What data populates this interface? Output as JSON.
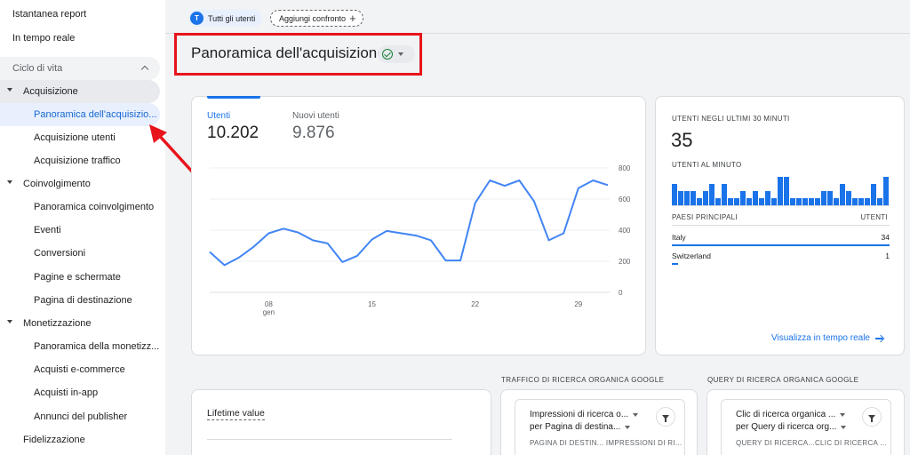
{
  "sidebar": {
    "items": [
      {
        "label": "Istantanea report"
      },
      {
        "label": "In tempo reale"
      },
      {
        "label": "Ciclo di vita"
      },
      {
        "label": "Acquisizione"
      },
      {
        "label": "Panoramica dell'acquisizio..."
      },
      {
        "label": "Acquisizione utenti"
      },
      {
        "label": "Acquisizione traffico"
      },
      {
        "label": "Coinvolgimento"
      },
      {
        "label": "Panoramica coinvolgimento"
      },
      {
        "label": "Eventi"
      },
      {
        "label": "Conversioni"
      },
      {
        "label": "Pagine e schermate"
      },
      {
        "label": "Pagina di destinazione"
      },
      {
        "label": "Monetizzazione"
      },
      {
        "label": "Panoramica della monetizz..."
      },
      {
        "label": "Acquisti e-commerce"
      },
      {
        "label": "Acquisti in-app"
      },
      {
        "label": "Annunci del publisher"
      },
      {
        "label": "Fidelizzazione"
      }
    ]
  },
  "topbar": {
    "all_users_avatar": "T",
    "all_users_label": "Tutti gli utenti",
    "add_compare_label": "Aggiungi confronto"
  },
  "page": {
    "title": "Panoramica dell'acquisizione"
  },
  "metrics": {
    "users_label": "Utenti",
    "users_value": "10.202",
    "new_users_label": "Nuovi utenti",
    "new_users_value": "9.876"
  },
  "chart_data": {
    "type": "line",
    "series": [
      {
        "values": [
          260,
          175,
          225,
          295,
          380,
          410,
          385,
          335,
          315,
          195,
          235,
          340,
          395,
          380,
          365,
          335,
          205,
          205,
          575,
          720,
          685,
          720,
          585,
          335,
          380,
          670,
          720,
          690
        ]
      }
    ],
    "ylim": [
      0,
      800
    ],
    "y_ticks": [
      "800",
      "600",
      "400",
      "200",
      "0"
    ],
    "x_ticks": [
      "08\ngen",
      "15",
      "22",
      "29"
    ],
    "xlabel": "",
    "ylabel": "",
    "grid": true,
    "color": "#4285f4"
  },
  "realtime": {
    "users_30_min_label": "UTENTI NEGLI ULTIMI 30 MINUTI",
    "users_30_min_value": "35",
    "users_per_min_label": "UTENTI AL MINUTO",
    "per_minute_values": [
      3,
      2,
      2,
      2,
      1,
      2,
      3,
      1,
      3,
      1,
      1,
      2,
      1,
      2,
      1,
      2,
      1,
      4,
      4,
      1,
      1,
      1,
      1,
      1,
      2,
      2,
      1,
      3,
      2,
      1,
      1,
      1,
      3,
      1,
      4
    ],
    "top_countries_label": "PAESI PRINCIPALI",
    "users_col_label": "UTENTI",
    "countries": [
      {
        "name": "Italy",
        "value": "34",
        "share": 1.0
      },
      {
        "name": "Switzerland",
        "value": "1",
        "share": 0.03
      }
    ],
    "view_realtime_label": "Visualizza in tempo reale"
  },
  "bottom": {
    "lifetime_label": "Lifetime value",
    "gsc_traffic_title": "TRAFFICO DI RICERCA ORGANICA GOOGLE",
    "gsc_traffic_dd1": "Impressioni di ricerca o...",
    "gsc_traffic_dd2": "per Pagina di destina...",
    "gsc_traffic_cols": "PAGINA DI DESTIN... IMPRESSIONI DI RI...",
    "gsc_query_title": "QUERY DI RICERCA ORGANICA GOOGLE",
    "gsc_query_dd1": "Clic di ricerca organica ...",
    "gsc_query_dd2": "per Query di ricerca org...",
    "gsc_query_cols": "QUERY DI RICERCA...CLIC DI RICERCA ..."
  },
  "colors": {
    "accent": "#1a73e8",
    "chart_line": "#4285f4",
    "annotation": "#e8141c"
  },
  "icons": [
    "chevron-up-icon",
    "caret-down-icon",
    "plus-icon",
    "check-circle-icon",
    "filter-icon",
    "arrow-right-icon"
  ]
}
